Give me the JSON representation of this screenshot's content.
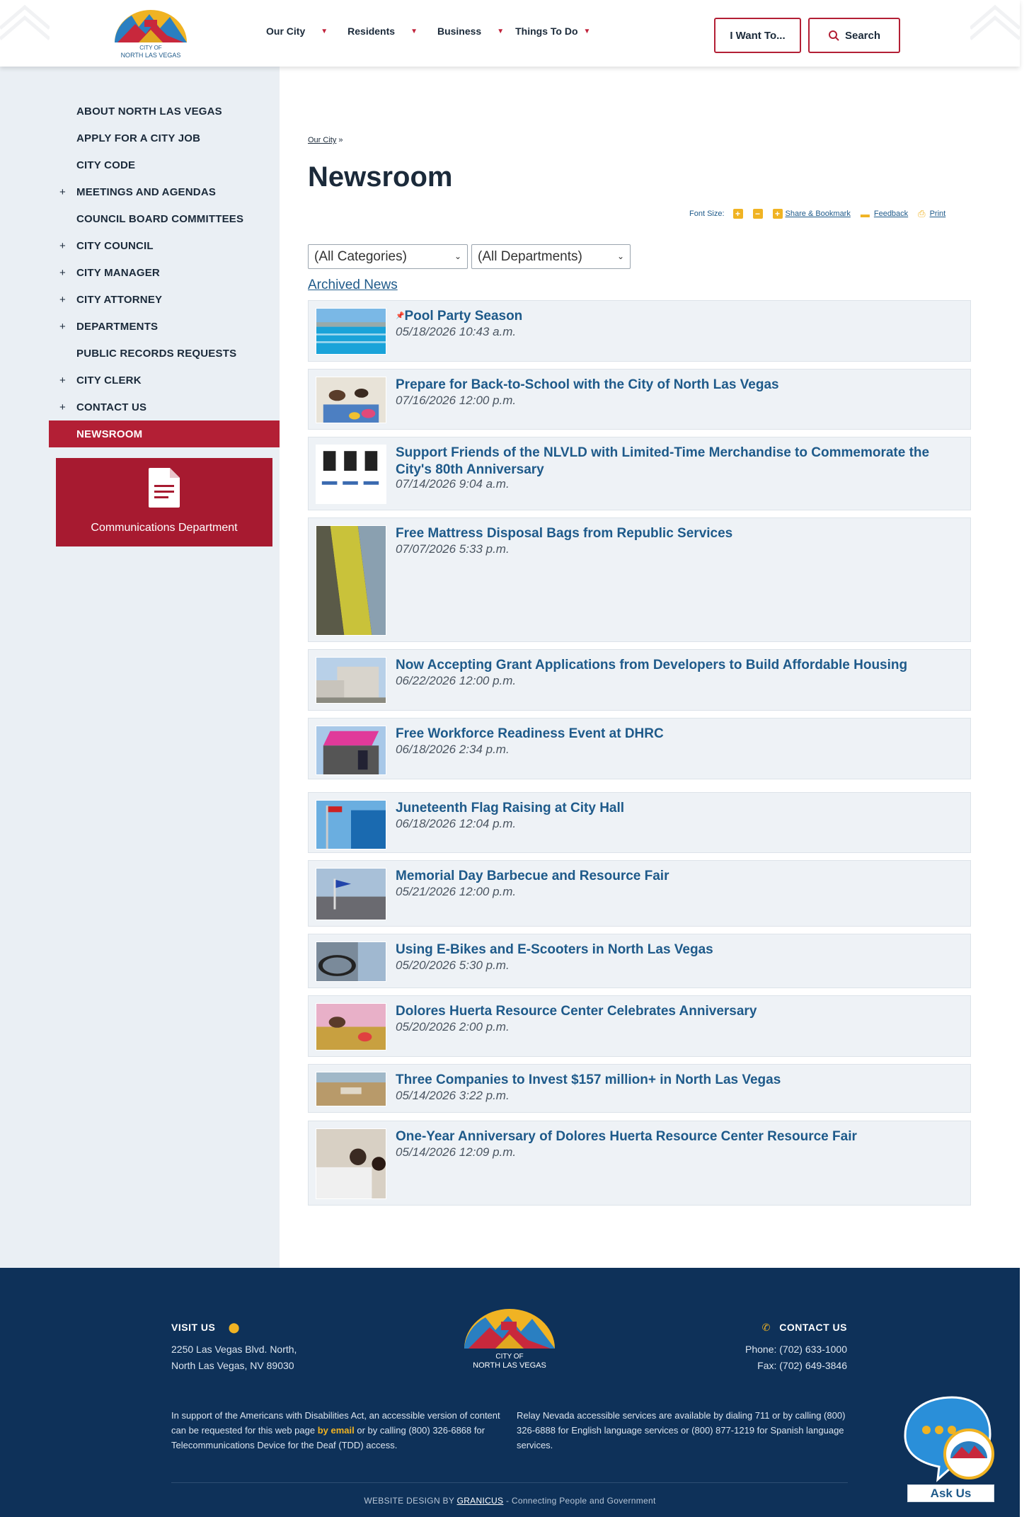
{
  "header": {
    "nav": [
      {
        "label": "Our City"
      },
      {
        "label": "Residents"
      },
      {
        "label": "Business"
      },
      {
        "label": "Things To Do"
      }
    ],
    "want_button": "I Want To...",
    "search_button": "Search",
    "logo_text": [
      "CITY OF",
      "NORTH LAS VEGAS"
    ]
  },
  "sidebar": {
    "items": [
      {
        "label": "ABOUT NORTH LAS VEGAS",
        "expandable": false
      },
      {
        "label": "APPLY FOR A CITY JOB",
        "expandable": false
      },
      {
        "label": "CITY CODE",
        "expandable": false
      },
      {
        "label": "MEETINGS AND AGENDAS",
        "expandable": true
      },
      {
        "label": "COUNCIL BOARD COMMITTEES",
        "expandable": false
      },
      {
        "label": "CITY COUNCIL",
        "expandable": true
      },
      {
        "label": "CITY MANAGER",
        "expandable": true
      },
      {
        "label": "CITY ATTORNEY",
        "expandable": true
      },
      {
        "label": "DEPARTMENTS",
        "expandable": true
      },
      {
        "label": "PUBLIC RECORDS REQUESTS",
        "expandable": false
      },
      {
        "label": "CITY CLERK",
        "expandable": true
      },
      {
        "label": "CONTACT US",
        "expandable": true
      },
      {
        "label": "NEWSROOM",
        "expandable": false,
        "active": true
      }
    ],
    "plus_symbol": "+",
    "card_label": "Communications Department"
  },
  "main": {
    "breadcrumb": "Our City",
    "breadcrumb_sep": "»",
    "title": "Newsroom",
    "tools": {
      "font_size_label": "Font Size:",
      "increase": "+",
      "decrease": "−",
      "share": "Share & Bookmark",
      "feedback": "Feedback",
      "print": "Print"
    },
    "category_select": "(All Categories)",
    "department_select": "(All Departments)",
    "archived_link": "Archived News",
    "news": [
      {
        "title": "Pool Party Season",
        "date": "05/18/2026 10:43 a.m.",
        "pinned": true
      },
      {
        "title": "Prepare for Back-to-School with the City of North Las Vegas",
        "date": "07/16/2026 12:00 p.m."
      },
      {
        "title": "Support Friends of the NLVLD with Limited-Time Merchandise to Commemorate the City's 80th Anniversary",
        "date": "07/14/2026 9:04 a.m."
      },
      {
        "title": "Free Mattress Disposal Bags from Republic Services",
        "date": "07/07/2026 5:33 p.m."
      },
      {
        "title": "Now Accepting Grant Applications from Developers to Build Affordable Housing",
        "date": "06/22/2026 12:00 p.m."
      },
      {
        "title": "Free Workforce Readiness Event at DHRC",
        "date": "06/18/2026 2:34 p.m."
      },
      {
        "title": "Juneteenth Flag Raising at City Hall",
        "date": "06/18/2026 12:04 p.m."
      },
      {
        "title": "Memorial Day Barbecue and Resource Fair",
        "date": "05/21/2026 12:00 p.m."
      },
      {
        "title": "Using E-Bikes and E-Scooters in North Las Vegas",
        "date": "05/20/2026 5:30 p.m."
      },
      {
        "title": "Dolores Huerta Resource Center Celebrates Anniversary",
        "date": "05/20/2026 2:00 p.m."
      },
      {
        "title": "Three Companies to Invest $157 million+ in North Las Vegas",
        "date": "05/14/2026 3:22 p.m."
      },
      {
        "title": "One-Year Anniversary of Dolores Huerta Resource Center Resource Fair",
        "date": "05/14/2026 12:09 p.m."
      }
    ]
  },
  "footer": {
    "visit_heading": "VISIT US",
    "address1": "2250 Las Vegas Blvd. North,",
    "address2": "North Las Vegas, NV 89030",
    "contact_heading": "CONTACT US",
    "phone": "Phone: (702) 633-1000",
    "fax": "Fax: (702) 649-3846",
    "ada_pre": "In support of the Americans with Disabilities Act, an accessible version of content can be requested for this web page",
    "ada_link": "by email",
    "ada_post": "or by calling (800) 326-6868 for Telecommunications Device for the Deaf (TDD) access.",
    "relay": "Relay Nevada accessible services are available by dialing 711 or by calling (800) 326-6888 for English language services or (800) 877-1219 for Spanish language services.",
    "credit_pre": "WEBSITE DESIGN BY",
    "credit_link": "GRANICUS",
    "credit_post": "- Connecting People and Government",
    "ask_label": "Ask Us"
  },
  "colors": {
    "brand_red": "#b31f35",
    "link_blue": "#1e5a8a",
    "footer_navy": "#0e3159",
    "accent_gold": "#f0b323",
    "sidebar_bg": "#eaeff4"
  }
}
